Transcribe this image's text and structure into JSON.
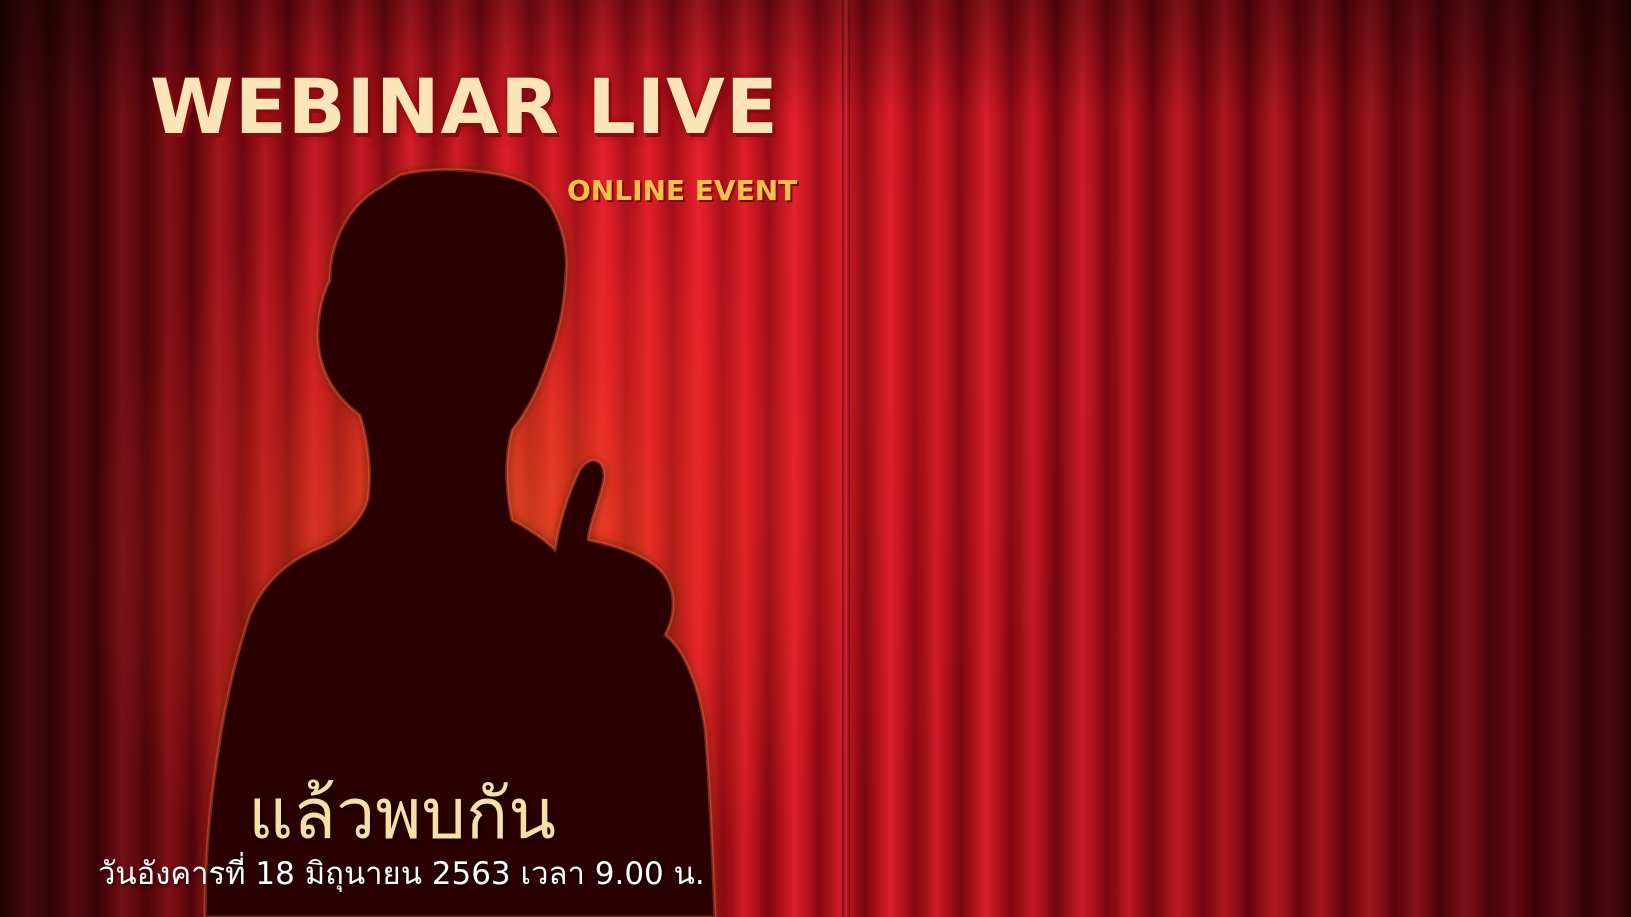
{
  "banner": {
    "title": "WEBINAR LIVE",
    "subtitle": "ONLINE EVENT",
    "headline": "แล้วพบกัน",
    "date_line": "วันอังคารที่ 18 มิถุนายน 2563 เวลา 9.00 น."
  },
  "colors": {
    "curtain": "#c8141f",
    "title_text": "#fbe4b8",
    "subtitle_text": "#f4c049",
    "headline_text": "#f8dfa6",
    "date_text": "#ffffff",
    "silhouette": "#2a0204"
  },
  "images": {
    "background": "red-stage-curtain",
    "figure": "person-silhouette-thumbs-up"
  }
}
